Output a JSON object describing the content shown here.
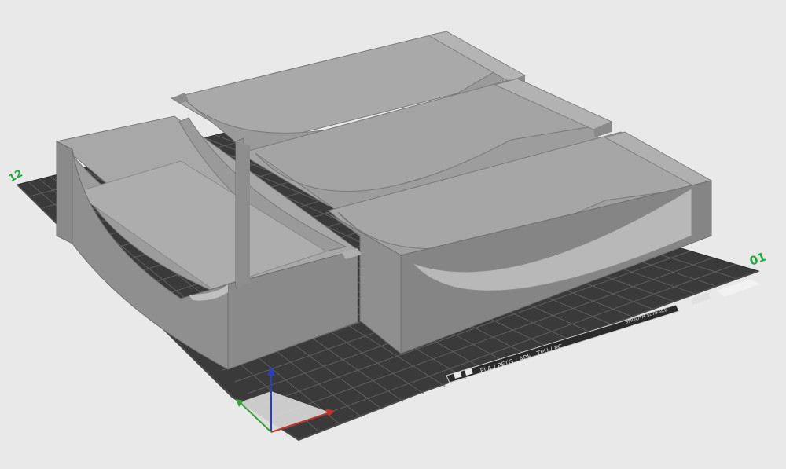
{
  "bed": {
    "axis_label_top_left": "12",
    "axis_label_right": "01",
    "material_strip": "PLA / PETG / ABS / TPU / PC",
    "texture_strip": "SMOOTH SURFACE"
  },
  "colors": {
    "background": "#e9e9e9",
    "bed": "#3a3a3a",
    "grid": "#5a5a5a",
    "model_light": "#a9a9a9",
    "model_mid": "#969696",
    "model_dark": "#7c7c7c",
    "axis_x": "#c9302c",
    "axis_y": "#3aa13a",
    "axis_z": "#2a3fbf",
    "bed_label_green": "#1faa3a"
  },
  "icons": [
    "print-bed-plate",
    "axis-gizmo",
    "bed-logo-icon"
  ]
}
